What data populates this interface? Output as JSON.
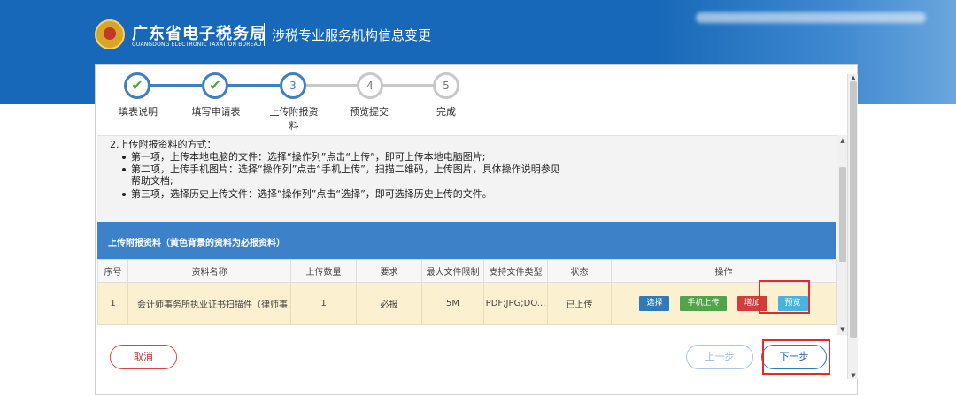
{
  "header": {
    "brand_cn": "广东省电子税务局",
    "brand_en": "GUANGDONG ELECTRONIC TAXATION BUREAU",
    "page_title": "涉税专业服务机构信息变更"
  },
  "steps": [
    {
      "symbol": "✔",
      "label": "填表说明",
      "status": "done"
    },
    {
      "symbol": "✔",
      "label": "填写申请表",
      "status": "done"
    },
    {
      "symbol": "3",
      "label": "上传附报资料",
      "status": "current"
    },
    {
      "symbol": "4",
      "label": "预览提交",
      "status": "todo"
    },
    {
      "symbol": "5",
      "label": "完成",
      "status": "todo"
    }
  ],
  "instructions": {
    "title": "2.上传附报资料的方式：",
    "items": [
      "第一项，上传本地电脑的文件：选择“操作列”点击“上传”，即可上传本地电脑图片;",
      "第二项，上传手机图片：选择“操作列”点击“手机上传”，扫描二维码，上传图片，具体操作说明参见",
      "第三项，选择历史上传文件：选择“操作列”点击“选择”，即可选择历史上传的文件。"
    ],
    "continuation": "帮助文档;"
  },
  "table": {
    "section_title": "上传附报资料（黄色背景的资料为必报资料）",
    "columns": [
      "序号",
      "资料名称",
      "上传数量",
      "要求",
      "最大文件限制",
      "支持文件类型",
      "状态",
      "操作"
    ],
    "rows": [
      {
        "index": "1",
        "name": "会计师事务所执业证书扫描件（律师事...",
        "count": "1",
        "requirement": "必报",
        "max_size": "5M",
        "file_types": "PDF;JPG;DO...",
        "status": "已上传",
        "actions": {
          "select": "选择",
          "phone_upload": "手机上传",
          "add": "增加",
          "preview": "预览"
        }
      }
    ]
  },
  "buttons": {
    "cancel": "取消",
    "prev": "上一步",
    "next": "下一步"
  },
  "colors": {
    "header_blue": "#1768b8",
    "table_header_blue": "#3d82c9",
    "required_row": "#fbf0cf",
    "highlight_red": "#e42a2a"
  }
}
